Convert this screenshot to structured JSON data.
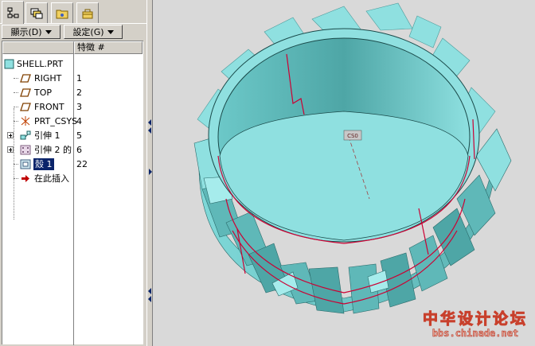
{
  "tabs": [
    {
      "id": "model-tree",
      "icon": "model-tree-icon"
    },
    {
      "id": "layers",
      "icon": "layers-icon"
    },
    {
      "id": "folder-browser",
      "icon": "folder-icon"
    },
    {
      "id": "favorites",
      "icon": "toolbox-icon"
    }
  ],
  "menus": {
    "display_label": "顯示(D)",
    "settings_label": "設定(G)"
  },
  "tree": {
    "column_header": "特徵 #",
    "items": [
      {
        "label": "SHELL.PRT",
        "num": "",
        "icon": "part-icon"
      },
      {
        "label": "RIGHT",
        "num": "1",
        "icon": "datum-plane-icon"
      },
      {
        "label": "TOP",
        "num": "2",
        "icon": "datum-plane-icon"
      },
      {
        "label": "FRONT",
        "num": "3",
        "icon": "datum-plane-icon"
      },
      {
        "label": "PRT_CSYS",
        "num": "4",
        "icon": "coordinate-system-icon"
      },
      {
        "label": "引伸 1",
        "num": "5",
        "icon": "extrude-icon"
      },
      {
        "label": "引伸 2 的",
        "num": "6",
        "icon": "pattern-icon"
      },
      {
        "label": "殼 1",
        "num": "22",
        "icon": "shell-icon"
      },
      {
        "label": "在此插入",
        "num": "",
        "icon": "insert-here-arrow-icon"
      }
    ]
  },
  "viewport": {
    "background": "#d9d9d9",
    "part_color": "#8fe0e0",
    "part_shade": "#5fb8b8",
    "edge_color": "#000000",
    "highlight_color": "#cc0033",
    "csys_label": "CS0"
  },
  "watermark": {
    "title": "中华设计论坛",
    "url": "bbs.chinade.net"
  }
}
